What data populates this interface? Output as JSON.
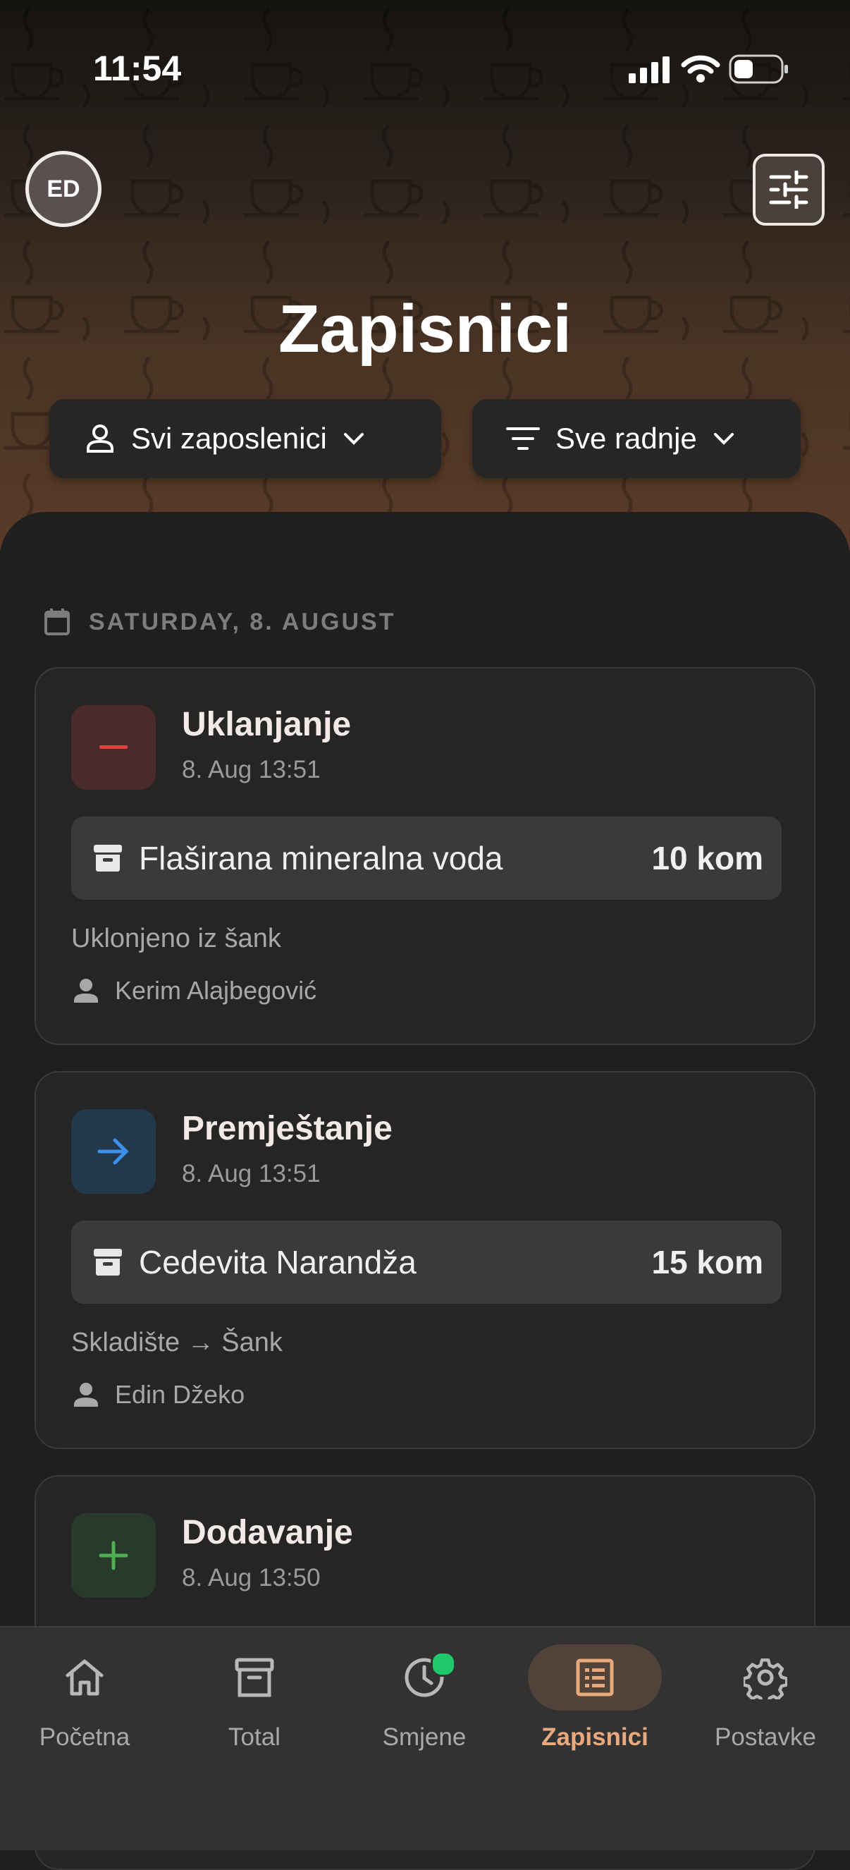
{
  "status_bar": {
    "time": "11:54"
  },
  "header": {
    "avatar_initials": "ED",
    "title": "Zapisnici"
  },
  "filters": [
    {
      "label": "Svi zaposlenici",
      "icon": "person-icon"
    },
    {
      "label": "Sve radnje",
      "icon": "filter-icon"
    }
  ],
  "day_header": "SATURDAY, 8. AUGUST",
  "entries": [
    {
      "type": "Uklanjanje",
      "time": "8. Aug 13:51",
      "item": "Flaširana mineralna voda",
      "quantity": "10 kom",
      "note": "Uklonjeno iz šank",
      "user": "Kerim Alajbegović",
      "icon": "minus-icon",
      "icon_color": "#e0433b",
      "icon_bg": "#4a2a2a"
    },
    {
      "type": "Premještanje",
      "time": "8. Aug 13:51",
      "item": "Cedevita Narandža",
      "quantity": "15 kom",
      "note": "Skladište → Šank",
      "user": "Edin Džeko",
      "icon": "arrow-right-icon",
      "icon_color": "#3b92e8",
      "icon_bg": "#23384d"
    },
    {
      "type": "Dodavanje",
      "time": "8. Aug 13:50",
      "icon": "plus-icon",
      "icon_color": "#4caf50",
      "icon_bg": "#283a29"
    }
  ],
  "bottom_nav": [
    {
      "label": "Početna",
      "icon": "home-icon"
    },
    {
      "label": "Total",
      "icon": "archive-icon"
    },
    {
      "label": "Smjene",
      "icon": "clock-icon",
      "badge": true
    },
    {
      "label": "Zapisnici",
      "icon": "list-icon",
      "active": true
    },
    {
      "label": "Postavke",
      "icon": "gear-icon"
    }
  ],
  "colors": {
    "accent": "#e8a97f",
    "badge": "#1ec86b"
  }
}
